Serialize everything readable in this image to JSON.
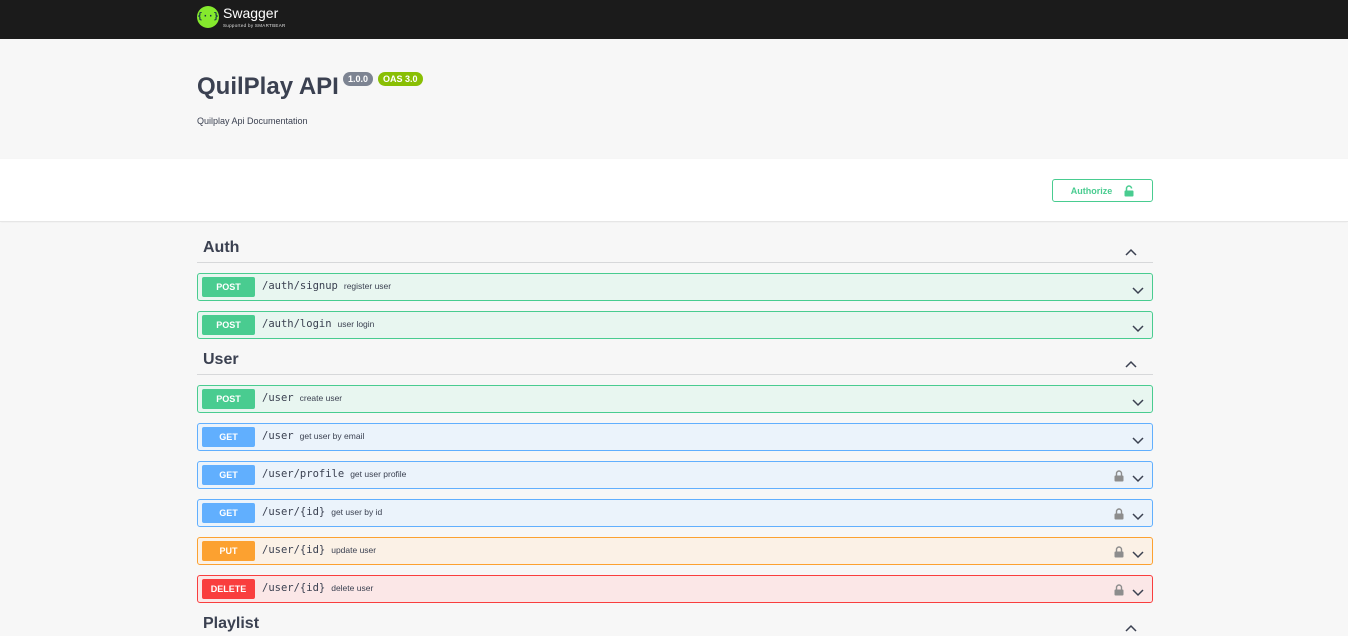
{
  "header": {
    "logo_mark": "{··}",
    "logo_name": "Swagger",
    "logo_sub": "Supported by SMARTBEAR"
  },
  "info": {
    "title": "QuilPlay API",
    "version": "1.0.0",
    "oas": "OAS 3.0",
    "description": "Quilplay Api Documentation"
  },
  "scheme": {
    "authorize_label": "Authorize"
  },
  "tags": [
    {
      "name": "Auth",
      "operations": [
        {
          "method": "POST",
          "path": "/auth/signup",
          "summary": "register user",
          "locked": false
        },
        {
          "method": "POST",
          "path": "/auth/login",
          "summary": "user login",
          "locked": false
        }
      ]
    },
    {
      "name": "User",
      "operations": [
        {
          "method": "POST",
          "path": "/user",
          "summary": "create user",
          "locked": false
        },
        {
          "method": "GET",
          "path": "/user",
          "summary": "get user by email",
          "locked": false
        },
        {
          "method": "GET",
          "path": "/user/profile",
          "summary": "get user profile",
          "locked": true
        },
        {
          "method": "GET",
          "path": "/user/{id}",
          "summary": "get user by id",
          "locked": true
        },
        {
          "method": "PUT",
          "path": "/user/{id}",
          "summary": "update user",
          "locked": true
        },
        {
          "method": "DELETE",
          "path": "/user/{id}",
          "summary": "delete user",
          "locked": true
        }
      ]
    },
    {
      "name": "Playlist",
      "operations": []
    }
  ],
  "colors": {
    "post": "#49cc90",
    "get": "#61affe",
    "put": "#fca130",
    "delete": "#f93e3e",
    "swagger_green": "#85ea2d"
  }
}
